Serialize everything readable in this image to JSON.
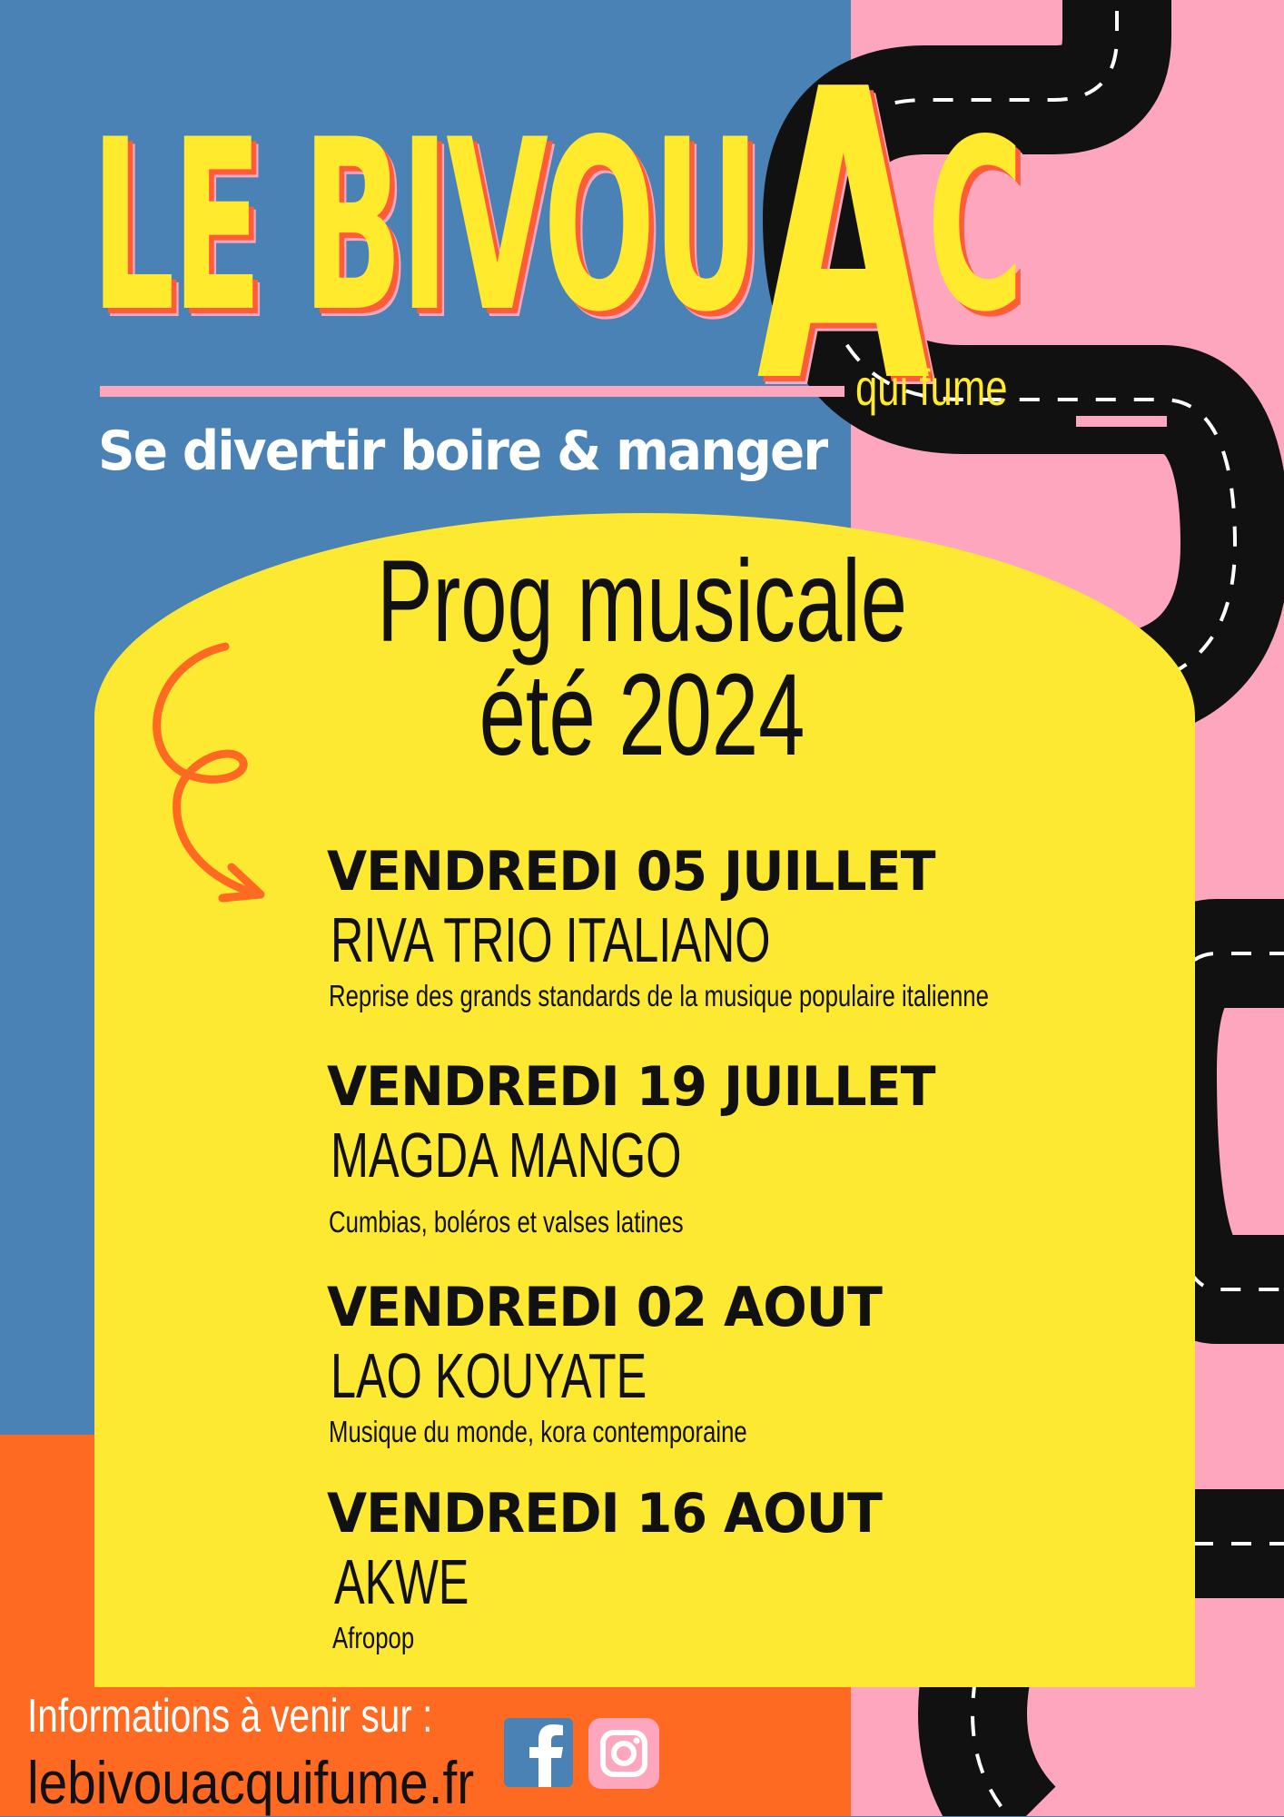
{
  "brand": {
    "title_main": "LE BIVOU",
    "title_a": "A",
    "title_end": "C",
    "subtitle": "qui fume",
    "tagline": "Se divertir boire & manger"
  },
  "program": {
    "title_line1": "Prog musicale",
    "title_line2": "été 2024",
    "events": [
      {
        "date": "VENDREDI 05 JUILLET",
        "artist": "RIVA TRIO ITALIANO",
        "description": "Reprise des grands standards de la musique populaire italienne"
      },
      {
        "date": "VENDREDI 19 JUILLET",
        "artist": "MAGDA MANGO",
        "description": "Cumbias, boléros et valses latines"
      },
      {
        "date": "VENDREDI 02 AOUT",
        "artist": "LAO KOUYATE",
        "description": "Musique du monde, kora contemporaine"
      },
      {
        "date": "VENDREDI 16 AOUT",
        "artist": "AKWE",
        "description": "Afropop"
      }
    ]
  },
  "footer": {
    "info": "Informations à venir sur :",
    "url": "lebivouacquifume.fr",
    "icons": [
      "facebook-icon",
      "instagram-icon"
    ]
  },
  "colors": {
    "blue": "#4a82b6",
    "pink": "#ffa6bf",
    "orange": "#ff6a23",
    "yellow": "#fde931",
    "title_yellow": "#ffea2e"
  }
}
